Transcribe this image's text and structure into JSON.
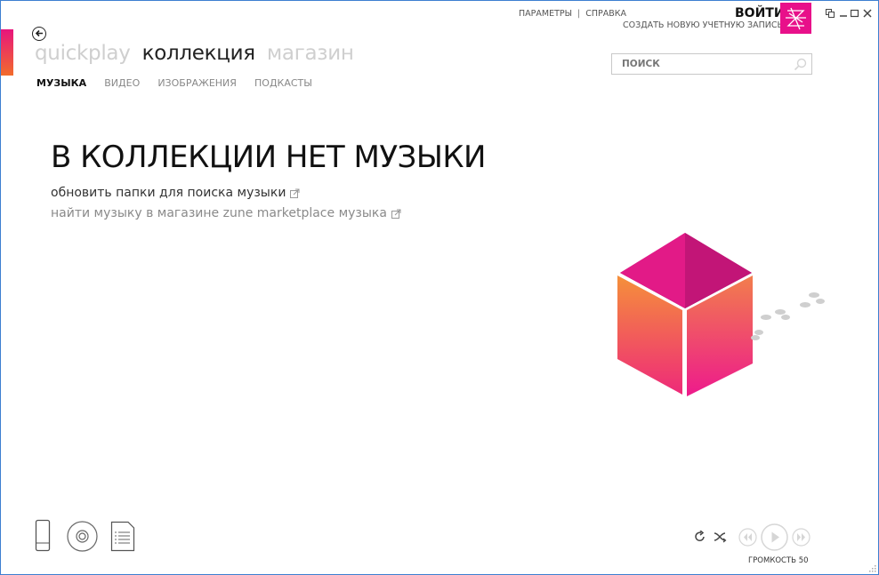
{
  "header": {
    "top_links": [
      "ПАРАМЕТРЫ",
      "СПРАВКА"
    ],
    "separator": "|",
    "sign_in": "ВОЙТИ",
    "create_account": "СОЗДАТЬ НОВУЮ УЧЕТНУЮ ЗАПИСЬ"
  },
  "nav": {
    "pivots": [
      {
        "label": "quickplay",
        "active": false
      },
      {
        "label": "коллекция",
        "active": true
      },
      {
        "label": "магазин",
        "active": false
      }
    ],
    "subnav": [
      {
        "label": "МУЗЫКА",
        "active": true
      },
      {
        "label": "ВИДЕО",
        "active": false
      },
      {
        "label": "ИЗОБРАЖЕНИЯ",
        "active": false
      },
      {
        "label": "ПОДКАСТЫ",
        "active": false
      }
    ]
  },
  "search": {
    "placeholder": "ПОИСК",
    "value": ""
  },
  "main": {
    "title": "В КОЛЛЕКЦИИ НЕТ МУЗЫКИ",
    "update_folders_link": "обновить папки для поиска музыки",
    "marketplace_link": "найти музыку в магазине zune marketplace музыка"
  },
  "player": {
    "volume_label": "ГРОМКОСТЬ 50"
  },
  "colors": {
    "accent_magenta": "#e8108a",
    "accent_orange": "#f58a3a",
    "window_border": "#3d7fd1"
  },
  "icons": {
    "back": "back-arrow-icon",
    "search": "magnifier-icon",
    "external_link": "external-link-icon",
    "device": "device-icon",
    "disc": "disc-icon",
    "playlist": "playlist-icon",
    "repeat": "repeat-icon",
    "shuffle": "shuffle-icon",
    "previous": "previous-icon",
    "play": "play-icon",
    "next": "next-icon"
  }
}
